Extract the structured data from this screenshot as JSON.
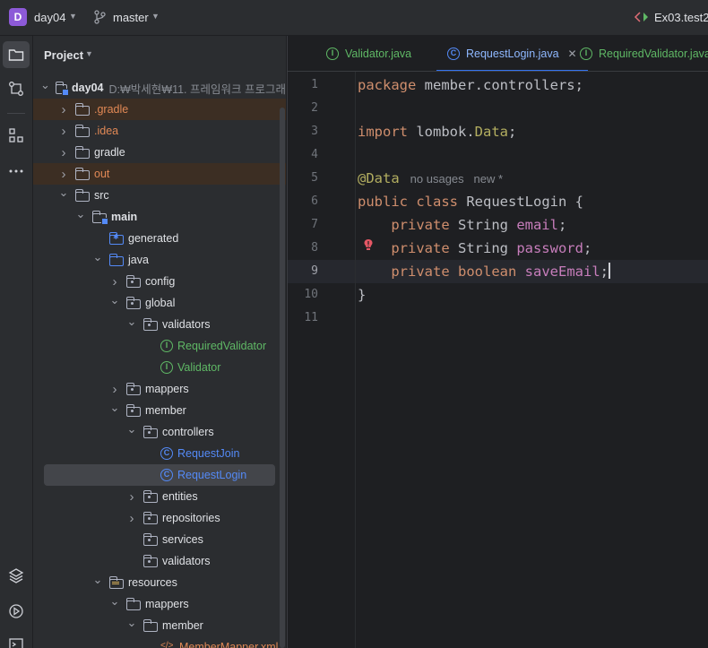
{
  "titlebar": {
    "project_letter": "D",
    "project_name": "day04",
    "branch": "master",
    "run_config": "Ex03.test2"
  },
  "toolstrip": {
    "top": [
      "folder-icon",
      "commit-icon",
      "structure-icon",
      "more-icon"
    ],
    "bottom": [
      "layers-icon",
      "services-icon",
      "terminal-icon"
    ]
  },
  "project_panel": {
    "title": "Project",
    "tree": [
      {
        "label": "day04",
        "path": "D:₩박세현₩11. 프레임워크 프로그래",
        "depth": 0,
        "chevron": "down",
        "icon": "module",
        "style": "bold"
      },
      {
        "label": ".gradle",
        "depth": 1,
        "chevron": "right",
        "icon": "folder",
        "style": "orange",
        "excluded": true
      },
      {
        "label": ".idea",
        "depth": 1,
        "chevron": "right",
        "icon": "folder",
        "style": "orange"
      },
      {
        "label": "gradle",
        "depth": 1,
        "chevron": "right",
        "icon": "folder",
        "style": "normal"
      },
      {
        "label": "out",
        "depth": 1,
        "chevron": "right",
        "icon": "folder",
        "style": "orange",
        "excluded": true
      },
      {
        "label": "src",
        "depth": 1,
        "chevron": "down",
        "icon": "folder",
        "style": "normal"
      },
      {
        "label": "main",
        "depth": 2,
        "chevron": "down",
        "icon": "module",
        "style": "bold"
      },
      {
        "label": "generated",
        "depth": 3,
        "chevron": "none",
        "icon": "generated",
        "style": "normal"
      },
      {
        "label": "java",
        "depth": 3,
        "chevron": "down",
        "icon": "source",
        "style": "normal"
      },
      {
        "label": "config",
        "depth": 4,
        "chevron": "right",
        "icon": "package",
        "style": "normal"
      },
      {
        "label": "global",
        "depth": 4,
        "chevron": "down",
        "icon": "package",
        "style": "normal"
      },
      {
        "label": "validators",
        "depth": 5,
        "chevron": "down",
        "icon": "package",
        "style": "normal"
      },
      {
        "label": "RequiredValidator",
        "depth": 6,
        "chevron": "none",
        "icon": "interface",
        "style": "green"
      },
      {
        "label": "Validator",
        "depth": 6,
        "chevron": "none",
        "icon": "interface",
        "style": "green"
      },
      {
        "label": "mappers",
        "depth": 4,
        "chevron": "right",
        "icon": "package",
        "style": "normal"
      },
      {
        "label": "member",
        "depth": 4,
        "chevron": "down",
        "icon": "package",
        "style": "normal"
      },
      {
        "label": "controllers",
        "depth": 5,
        "chevron": "down",
        "icon": "package",
        "style": "normal"
      },
      {
        "label": "RequestJoin",
        "depth": 6,
        "chevron": "none",
        "icon": "class",
        "style": "blue"
      },
      {
        "label": "RequestLogin",
        "depth": 6,
        "chevron": "none",
        "icon": "class",
        "style": "blue",
        "selected": true
      },
      {
        "label": "entities",
        "depth": 5,
        "chevron": "right",
        "icon": "package",
        "style": "normal"
      },
      {
        "label": "repositories",
        "depth": 5,
        "chevron": "right",
        "icon": "package",
        "style": "normal"
      },
      {
        "label": "services",
        "depth": 5,
        "chevron": "none",
        "icon": "package",
        "style": "normal"
      },
      {
        "label": "validators",
        "depth": 5,
        "chevron": "none",
        "icon": "package",
        "style": "normal"
      },
      {
        "label": "resources",
        "depth": 3,
        "chevron": "down",
        "icon": "resources",
        "style": "normal"
      },
      {
        "label": "mappers",
        "depth": 4,
        "chevron": "down",
        "icon": "folder",
        "style": "normal"
      },
      {
        "label": "member",
        "depth": 5,
        "chevron": "down",
        "icon": "folder",
        "style": "normal"
      },
      {
        "label": "MemberMapper.xml",
        "depth": 6,
        "chevron": "none",
        "icon": "xml",
        "style": "orange"
      }
    ]
  },
  "editor": {
    "tabs": [
      {
        "label": "Validator.java",
        "icon": "interface",
        "style": "green",
        "active": false
      },
      {
        "label": "RequestLogin.java",
        "icon": "class",
        "style": "blue",
        "active": true,
        "closable": true
      },
      {
        "label": "RequiredValidator.java",
        "icon": "interface",
        "style": "green",
        "active": false
      }
    ],
    "current_line": 9,
    "lines": [
      [
        {
          "t": "package",
          "c": "kw"
        },
        {
          "t": " member.controllers;",
          "c": ""
        }
      ],
      [],
      [
        {
          "t": "import",
          "c": "kw"
        },
        {
          "t": " lombok.",
          "c": ""
        },
        {
          "t": "Data",
          "c": "ann"
        },
        {
          "t": ";",
          "c": ""
        }
      ],
      [],
      [
        {
          "t": "@Data",
          "c": "ann"
        },
        {
          "t": "no usages   new *",
          "c": "hint"
        }
      ],
      [
        {
          "t": "public",
          "c": "kw"
        },
        {
          "t": " ",
          "c": ""
        },
        {
          "t": "class",
          "c": "kw"
        },
        {
          "t": " RequestLogin {",
          "c": ""
        }
      ],
      [
        {
          "t": "    ",
          "c": ""
        },
        {
          "t": "private",
          "c": "kw"
        },
        {
          "t": " String ",
          "c": ""
        },
        {
          "t": "email",
          "c": "fld"
        },
        {
          "t": ";",
          "c": ""
        }
      ],
      [
        {
          "t": "    ",
          "c": ""
        },
        {
          "t": "private",
          "c": "kw"
        },
        {
          "t": " String ",
          "c": ""
        },
        {
          "t": "password",
          "c": "fld"
        },
        {
          "t": ";",
          "c": ""
        }
      ],
      [
        {
          "t": "    ",
          "c": ""
        },
        {
          "t": "private",
          "c": "kw"
        },
        {
          "t": " ",
          "c": ""
        },
        {
          "t": "boolean",
          "c": "kw"
        },
        {
          "t": " ",
          "c": ""
        },
        {
          "t": "saveEmail",
          "c": "fld"
        },
        {
          "t": ";",
          "c": ""
        },
        {
          "t": "",
          "c": "caret"
        }
      ],
      [
        {
          "t": "}",
          "c": ""
        }
      ],
      []
    ]
  }
}
